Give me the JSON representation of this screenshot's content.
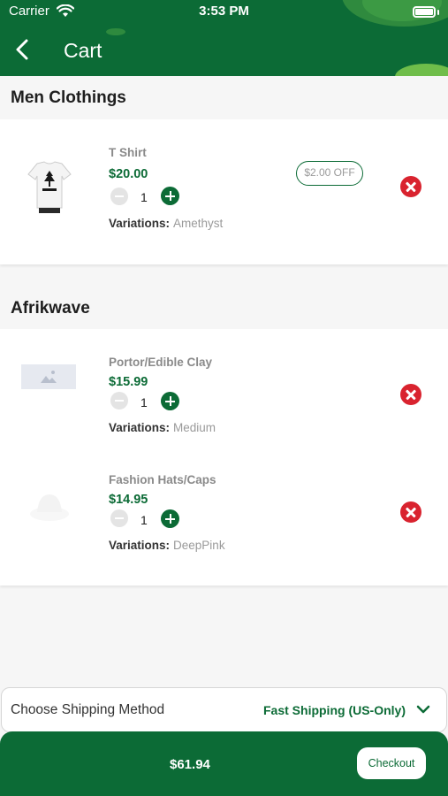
{
  "status_bar": {
    "carrier": "Carrier",
    "time": "3:53 PM"
  },
  "header": {
    "title": "Cart"
  },
  "stores": [
    {
      "name": "Men Clothings",
      "items": [
        {
          "name": "T Shirt",
          "price": "$20.00",
          "quantity": "1",
          "variation_label": "Variations:",
          "variation": "Amethyst",
          "discount": "$2.00 OFF"
        }
      ]
    },
    {
      "name": "Afrikwave",
      "items": [
        {
          "name": "Portor/Edible Clay",
          "price": "$15.99",
          "quantity": "1",
          "variation_label": "Variations:",
          "variation": "Medium"
        },
        {
          "name": "Fashion Hats/Caps",
          "price": "$14.95",
          "quantity": "1",
          "variation_label": "Variations:",
          "variation": "DeepPink"
        }
      ]
    }
  ],
  "shipping": {
    "label": "Choose Shipping Method",
    "value": "Fast Shipping (US-Only)"
  },
  "footer": {
    "total": "$61.94",
    "checkout_label": "Checkout"
  },
  "colors": {
    "brand_green": "#0c6b36",
    "remove_red": "#d9232f"
  }
}
